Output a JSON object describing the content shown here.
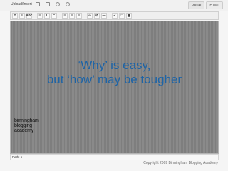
{
  "header": {
    "upload_insert_label": "Upload/Insert",
    "media_icons": [
      "image-icon",
      "video-icon",
      "music-icon",
      "media-icon"
    ]
  },
  "tabs": [
    {
      "label": "Visual",
      "active": true
    },
    {
      "label": "HTML",
      "active": false
    }
  ],
  "toolbar": {
    "buttons": [
      {
        "name": "bold-button",
        "label": "B"
      },
      {
        "name": "italic-button",
        "label": "I"
      },
      {
        "name": "strikethrough-button",
        "label": "abc"
      },
      {
        "name": "unordered-list-button",
        "label": "≡"
      },
      {
        "name": "ordered-list-button",
        "label": "1."
      },
      {
        "name": "blockquote-button",
        "label": "“"
      },
      {
        "name": "align-left-button",
        "label": "≡"
      },
      {
        "name": "align-center-button",
        "label": "≡"
      },
      {
        "name": "align-right-button",
        "label": "≡"
      },
      {
        "name": "link-button",
        "label": "∞"
      },
      {
        "name": "unlink-button",
        "label": "⊘"
      },
      {
        "name": "more-button",
        "label": "—"
      },
      {
        "name": "spellcheck-button",
        "label": "✓"
      },
      {
        "name": "fullscreen-button",
        "label": "□"
      },
      {
        "name": "kitchen-sink-button",
        "label": "▦"
      }
    ]
  },
  "content": {
    "headline_line1": "‘Why’ is easy,",
    "headline_line2": "but ‘how’ may be tougher",
    "logo_lines": [
      "birmingham",
      "blogging",
      "academy"
    ]
  },
  "footer": {
    "path_label": "Path: p",
    "copyright": "Copyright 2009 Birmingham Blogging Academy"
  },
  "colors": {
    "headline": "#1e64a6",
    "canvas": "#888888"
  }
}
